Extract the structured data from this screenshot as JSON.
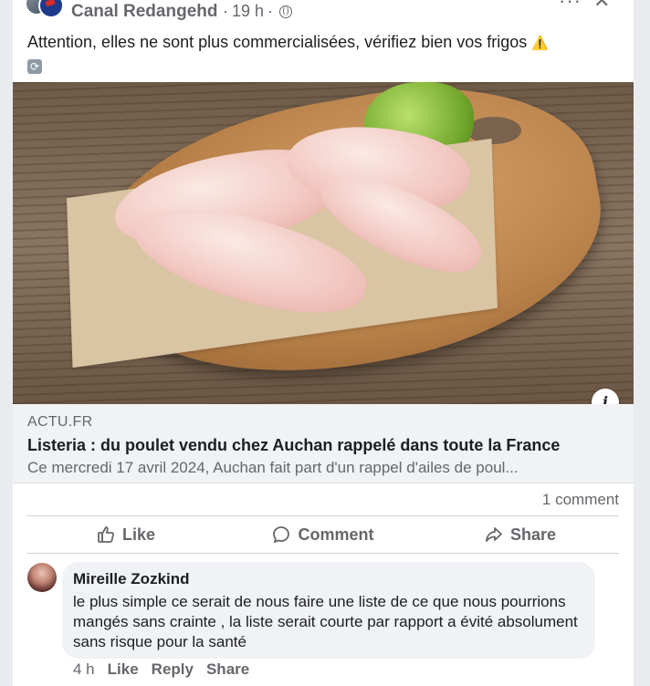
{
  "post": {
    "page_name": "Canal Redangehd",
    "time": "19 h",
    "separator": "·",
    "text": "Attention, elles ne sont plus commercialisées, vérifiez bien vos frigos",
    "icons": [
      "warning-icon",
      "cycle-icon",
      "globe-icon",
      "more-icon",
      "close-icon"
    ]
  },
  "link": {
    "domain": "ACTU.FR",
    "title": "Listeria : du poulet vendu chez Auchan rappelé dans toute la France",
    "description": "Ce mercredi 17 avril 2024, Auchan fait part d'un rappel d'ailes de poul..."
  },
  "stats": {
    "comments": "1 comment"
  },
  "actions": {
    "like": "Like",
    "comment": "Comment",
    "share": "Share"
  },
  "comment": {
    "author": "Mireille Zozkind",
    "text": "le plus simple ce serait de nous faire une liste de ce que nous pourrions mangés sans crainte , la liste serait courte par rapport a évité absolument sans risque pour la santé",
    "time": "4 h",
    "like": "Like",
    "reply": "Reply",
    "share": "Share"
  },
  "colors": {
    "background": "#e9ebee",
    "card": "#ffffff",
    "secondary_text": "#65676b",
    "bubble": "#f0f2f5"
  }
}
